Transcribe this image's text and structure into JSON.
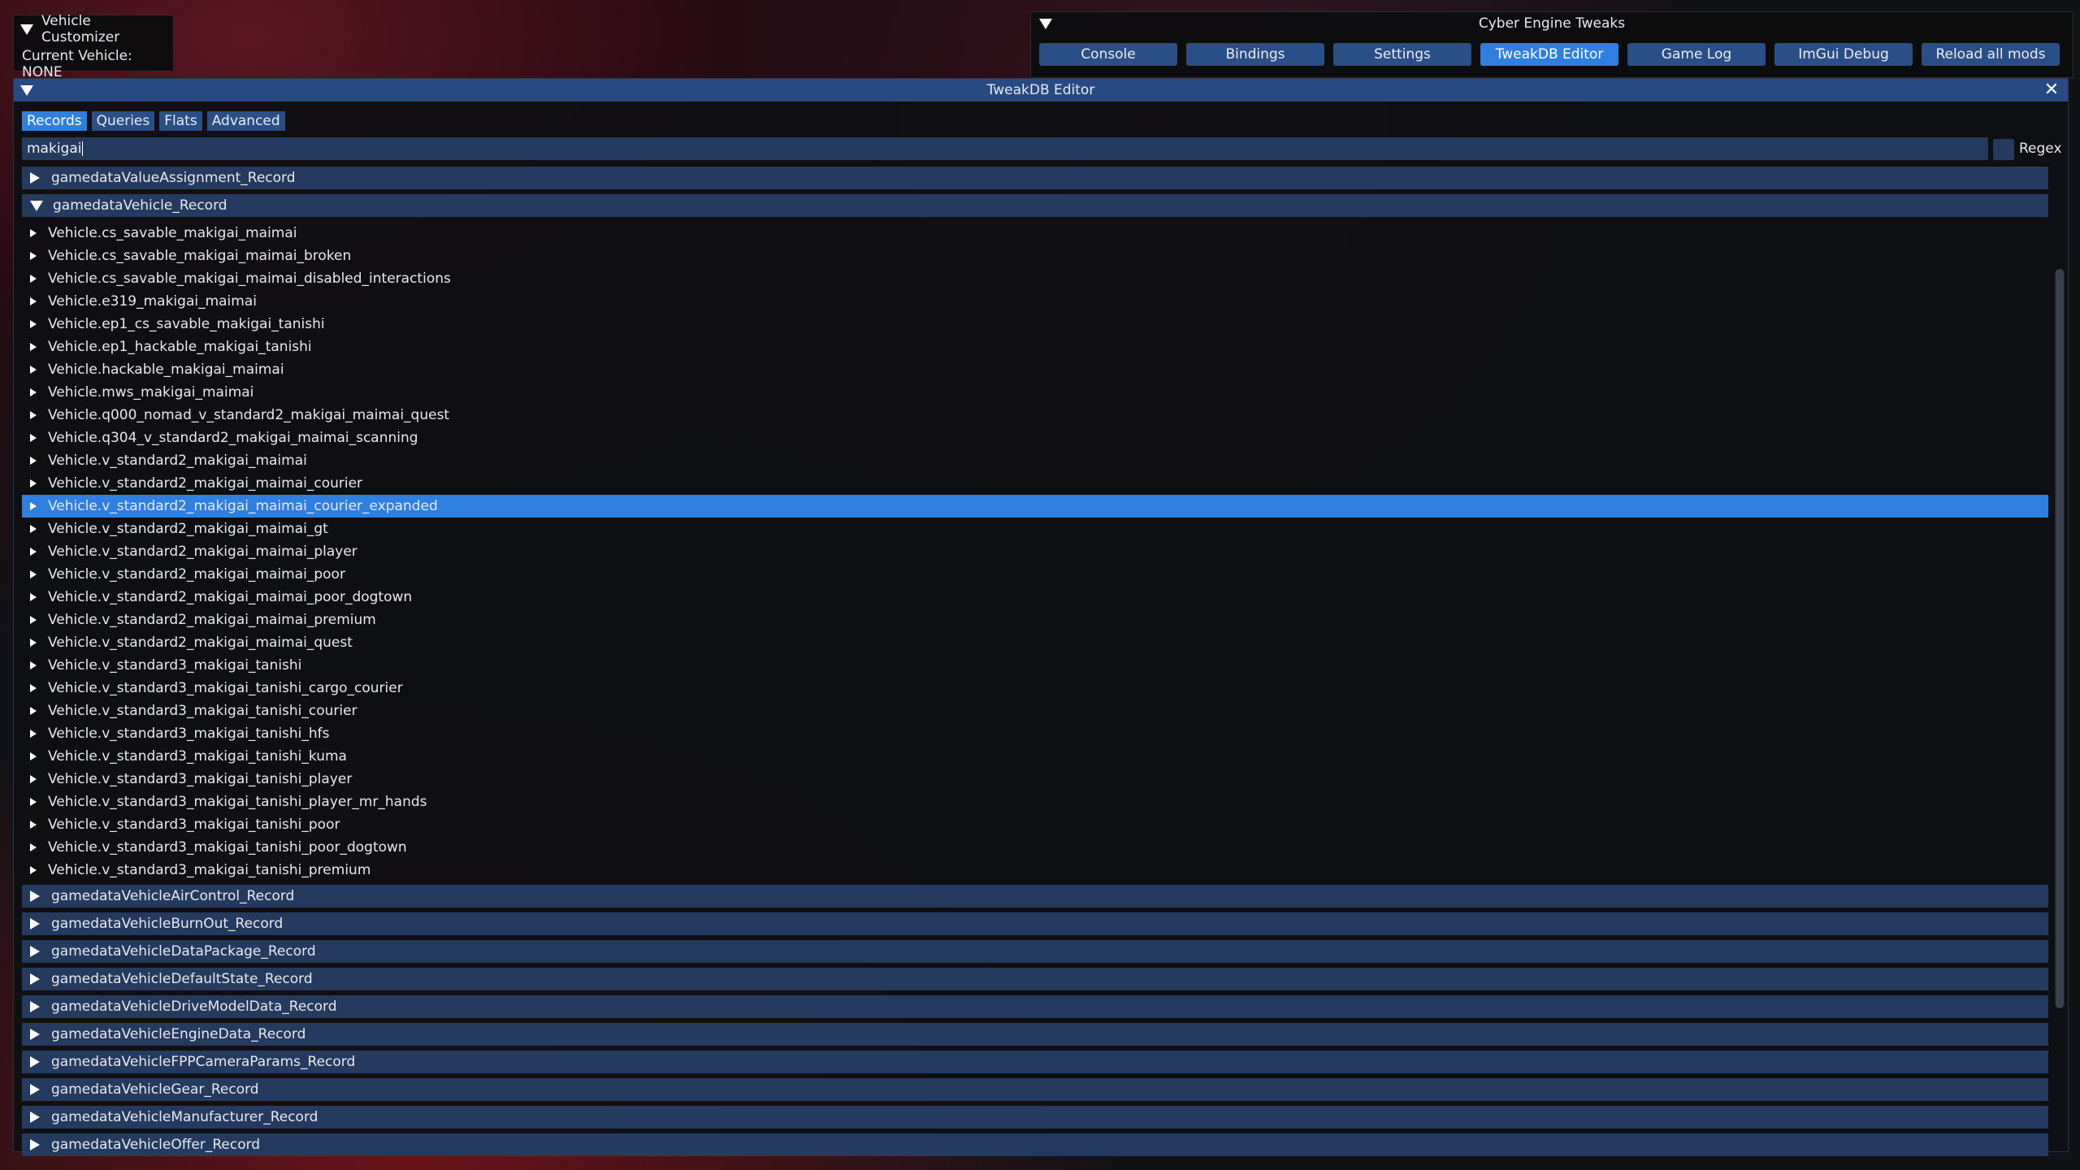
{
  "vehicle_customizer": {
    "title": "Vehicle Customizer",
    "current_vehicle": "Current Vehicle: NONE"
  },
  "cet": {
    "title": "Cyber Engine Tweaks",
    "buttons": [
      {
        "label": "Console",
        "active": false
      },
      {
        "label": "Bindings",
        "active": false
      },
      {
        "label": "Settings",
        "active": false
      },
      {
        "label": "TweakDB Editor",
        "active": true
      },
      {
        "label": "Game Log",
        "active": false
      },
      {
        "label": "ImGui Debug",
        "active": false
      },
      {
        "label": "Reload all mods",
        "active": false
      }
    ]
  },
  "tweakdb": {
    "title": "TweakDB Editor",
    "tabs": [
      {
        "label": "Records",
        "active": true
      },
      {
        "label": "Queries",
        "active": false
      },
      {
        "label": "Flats",
        "active": false
      },
      {
        "label": "Advanced",
        "active": false
      }
    ],
    "search_value": "makigai",
    "regex_label": "Regex",
    "groups_before": [
      "gamedataValueAssignment_Record"
    ],
    "open_group": "gamedataVehicle_Record",
    "items": [
      "Vehicle.cs_savable_makigai_maimai",
      "Vehicle.cs_savable_makigai_maimai_broken",
      "Vehicle.cs_savable_makigai_maimai_disabled_interactions",
      "Vehicle.e319_makigai_maimai",
      "Vehicle.ep1_cs_savable_makigai_tanishi",
      "Vehicle.ep1_hackable_makigai_tanishi",
      "Vehicle.hackable_makigai_maimai",
      "Vehicle.mws_makigai_maimai",
      "Vehicle.q000_nomad_v_standard2_makigai_maimai_quest",
      "Vehicle.q304_v_standard2_makigai_maimai_scanning",
      "Vehicle.v_standard2_makigai_maimai",
      "Vehicle.v_standard2_makigai_maimai_courier",
      "Vehicle.v_standard2_makigai_maimai_courier_expanded",
      "Vehicle.v_standard2_makigai_maimai_gt",
      "Vehicle.v_standard2_makigai_maimai_player",
      "Vehicle.v_standard2_makigai_maimai_poor",
      "Vehicle.v_standard2_makigai_maimai_poor_dogtown",
      "Vehicle.v_standard2_makigai_maimai_premium",
      "Vehicle.v_standard2_makigai_maimai_quest",
      "Vehicle.v_standard3_makigai_tanishi",
      "Vehicle.v_standard3_makigai_tanishi_cargo_courier",
      "Vehicle.v_standard3_makigai_tanishi_courier",
      "Vehicle.v_standard3_makigai_tanishi_hfs",
      "Vehicle.v_standard3_makigai_tanishi_kuma",
      "Vehicle.v_standard3_makigai_tanishi_player",
      "Vehicle.v_standard3_makigai_tanishi_player_mr_hands",
      "Vehicle.v_standard3_makigai_tanishi_poor",
      "Vehicle.v_standard3_makigai_tanishi_poor_dogtown",
      "Vehicle.v_standard3_makigai_tanishi_premium"
    ],
    "selected_item": "Vehicle.v_standard2_makigai_maimai_courier_expanded",
    "groups_after": [
      "gamedataVehicleAirControl_Record",
      "gamedataVehicleBurnOut_Record",
      "gamedataVehicleDataPackage_Record",
      "gamedataVehicleDefaultState_Record",
      "gamedataVehicleDriveModelData_Record",
      "gamedataVehicleEngineData_Record",
      "gamedataVehicleFPPCameraParams_Record",
      "gamedataVehicleGear_Record",
      "gamedataVehicleManufacturer_Record",
      "gamedataVehicleOffer_Record"
    ]
  }
}
